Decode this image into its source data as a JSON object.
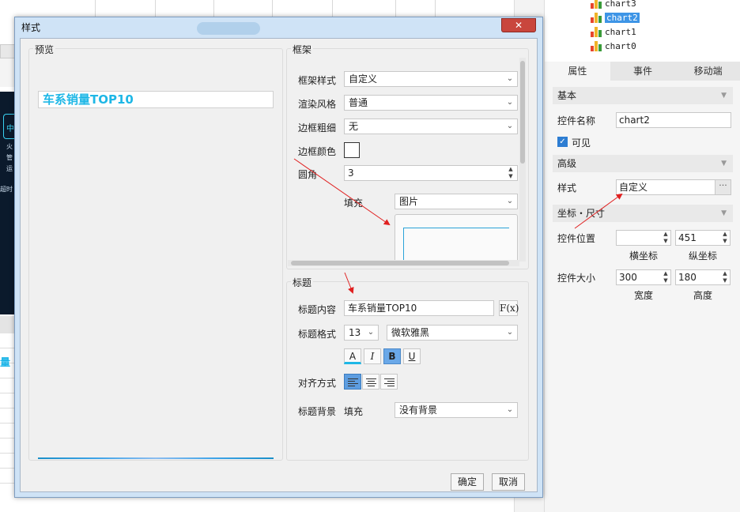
{
  "background": {
    "side_text": [
      "中",
      "火",
      "管",
      "运",
      "超时"
    ],
    "partial_text": "量"
  },
  "tree": {
    "items": [
      "chart3",
      "chart2",
      "chart1",
      "chart0"
    ]
  },
  "tabs": [
    "属性",
    "事件",
    "移动端"
  ],
  "props": {
    "basic_title": "基本",
    "name_label": "控件名称",
    "name_value": "chart2",
    "visible_label": "可见",
    "advanced_title": "高级",
    "style_label": "样式",
    "style_value": "自定义",
    "dots": "···",
    "coord_title": "坐标・尺寸",
    "pos_label": "控件位置",
    "pos_x_value": "",
    "pos_y_value": "451",
    "x_caption": "横坐标",
    "y_caption": "纵坐标",
    "size_label": "控件大小",
    "width_value": "300",
    "height_value": "180",
    "w_caption": "宽度",
    "h_caption": "高度"
  },
  "dialog": {
    "title": "样式",
    "close": "✕",
    "preview": {
      "group_title": "预览",
      "title_text": "车系销量TOP10"
    },
    "frame": {
      "group_title": "框架",
      "frame_style_label": "框架样式",
      "frame_style_value": "自定义",
      "render_label": "渲染风格",
      "render_value": "普通",
      "border_width_label": "边框粗细",
      "border_width_value": "无",
      "border_color_label": "边框颜色",
      "radius_label": "圆角",
      "radius_value": "3",
      "fill_label": "填充",
      "fill_value": "图片"
    },
    "title_section": {
      "group_title": "标题",
      "content_label": "标题内容",
      "content_value": "车系销量TOP10",
      "fx": "F(x)",
      "format_label": "标题格式",
      "font_size": "13",
      "font_family": "微软雅黑",
      "color_btn": "A",
      "italic_btn": "I",
      "bold_btn": "B",
      "underline_btn": "U",
      "align_label": "对齐方式",
      "bg_label": "标题背景",
      "bg_fill_label": "填充",
      "bg_value": "没有背景"
    },
    "ok": "确定",
    "cancel": "取消"
  },
  "colors": {
    "accent": "#1eb7e6",
    "selection": "#3e95e6",
    "close_red": "#c9463d",
    "annotation_red": "#e02020"
  }
}
